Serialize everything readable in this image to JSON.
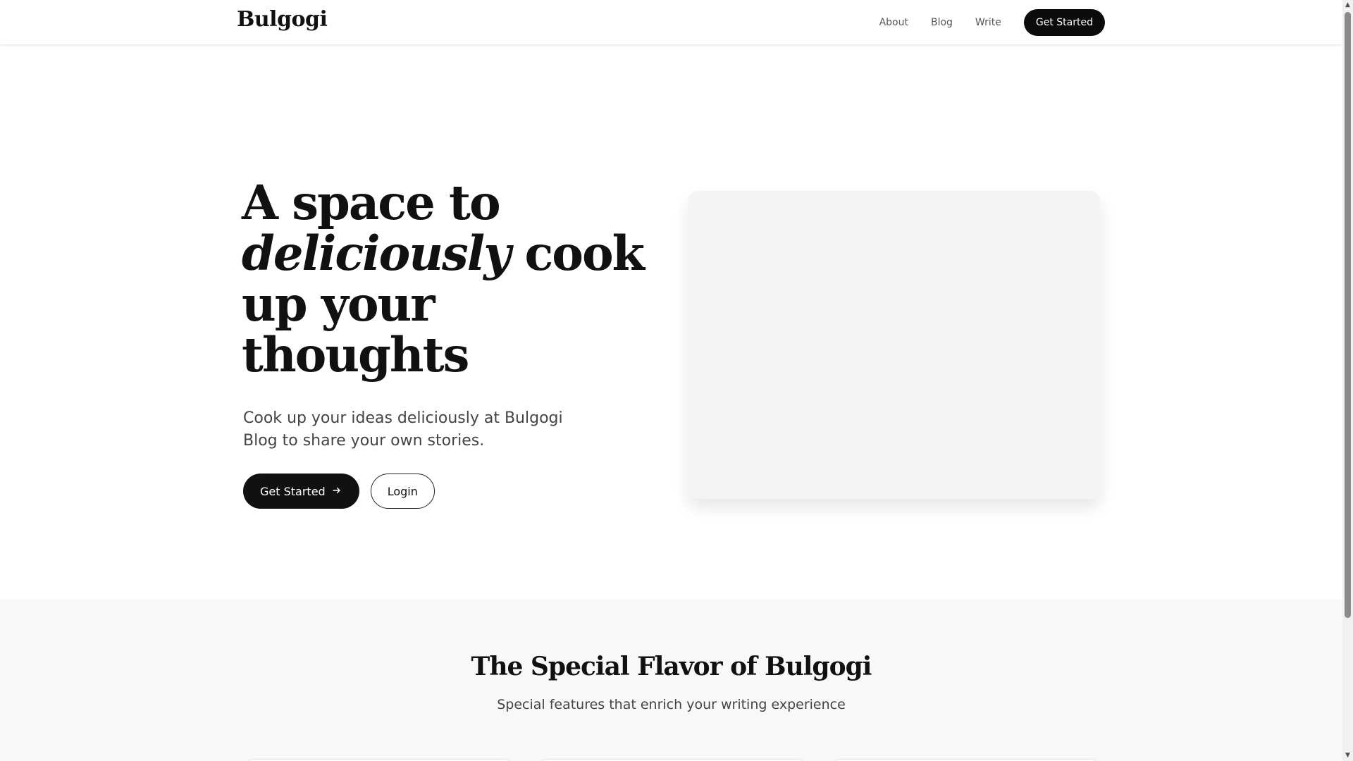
{
  "header": {
    "brand": "Bulgogi",
    "nav": [
      "About",
      "Blog",
      "Write"
    ],
    "cta": "Get Started"
  },
  "hero": {
    "title_line1": "A space to",
    "title_italic": "deliciously",
    "title_after_italic": "cook",
    "title_line3": "up your",
    "title_line4": "thoughts",
    "subtitle": "Cook up your ideas deliciously at Bulgogi Blog to share your own stories.",
    "primary_button": "Get Started",
    "primary_button_icon": "arrow-right-icon",
    "secondary_button": "Login"
  },
  "features": {
    "title": "The Special Flavor of Bulgogi",
    "subtitle": "Special features that enrich your writing experience"
  },
  "colors": {
    "primary": "#111111",
    "background": "#ffffff",
    "section_bg": "#f8f8f8",
    "placeholder": "#f4f4f4"
  }
}
